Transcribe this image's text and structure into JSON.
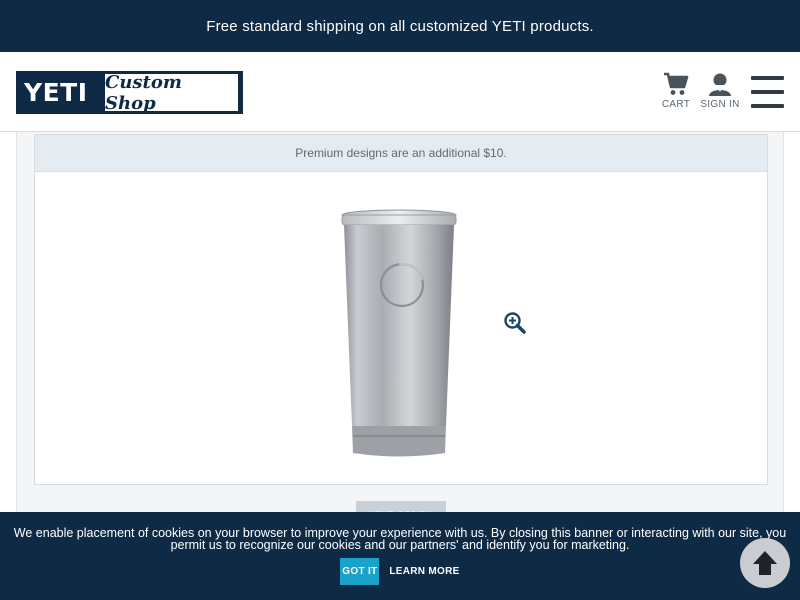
{
  "promo": {
    "text": "Free standard shipping on all customized YETI products."
  },
  "header": {
    "logo": {
      "brand": "YETI",
      "script": "Custom Shop"
    },
    "cart_label": "CART",
    "signin_label": "SIGN IN",
    "icons": {
      "cart": "cart-icon",
      "signin": "user-icon",
      "menu": "hamburger-menu-icon"
    }
  },
  "design": {
    "premium_note": "Premium designs are an additional $10.",
    "product_image": "stainless-tumbler",
    "zoom_icon": "zoom-in-icon",
    "next_button_label": "NEXT: DESIGN"
  },
  "cookie_banner": {
    "text": "We enable placement of cookies on your browser to improve your experience with us. By closing this banner or interacting with our site, you permit us to recognize our cookies and our partners' and identify you for marketing.",
    "got_it_label": "GOT IT",
    "learn_more_label": "LEARN MORE"
  },
  "back_to_top_icon": "arrow-up-icon",
  "colors": {
    "navy": "#0f2a45",
    "accent_blue": "#1aa3c8",
    "note_bg": "#e4ecf1",
    "text_gray": "#5c6a76"
  }
}
